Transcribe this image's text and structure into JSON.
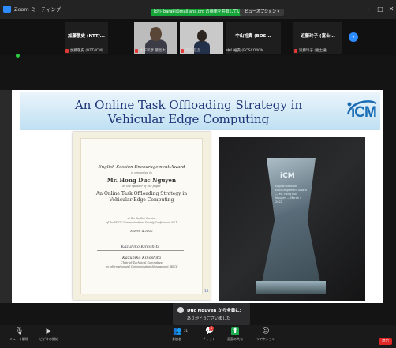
{
  "window": {
    "title": "Zoom ミーティング",
    "share_banner": "Ichi-Ibaraki@mail.ana.org の画面を共有しています",
    "view_options": "ビューオプション ▾",
    "view_link": "表示"
  },
  "participants": [
    {
      "center_name": "加藤敬史 (NTT/...",
      "footer": "加藤敬史 (NTT/ICM)",
      "muted": true,
      "has_video": false
    },
    {
      "center_name": "",
      "footer": "木下和彦 徳島大",
      "muted": true,
      "has_video": true
    },
    {
      "center_name": "",
      "footer": "阿多 信吾",
      "muted": true,
      "has_video": true
    },
    {
      "center_name": "中山裕貴 (BOS...",
      "footer": "中山裕貴 (BOSCO/ICM...",
      "muted": false,
      "has_video": false
    },
    {
      "center_name": "近藤玲子 (富士...",
      "footer": "近藤玲子 (富士通)",
      "muted": true,
      "has_video": false
    }
  ],
  "slide": {
    "title_line1": "An Online Task Offloading Strategy in",
    "title_line2": "Vehicular Edge Computing",
    "logo_text": "iCM",
    "page_number": "12"
  },
  "certificate": {
    "heading": "English Session Encouragement Award",
    "presented_to": "is presented to",
    "recipient": "Mr. Hong Duc Nguyen",
    "speaker_note": "as the speaker of the paper",
    "paper_line1": "An Online Task Offloading Strategy in",
    "paper_line2": "Vehicular Edge Computing",
    "session_line1": "at the English Session",
    "session_line2": "of the IEICE Communications Society Conference 2021",
    "date": "March 4 2022",
    "signature": "Kazuhiko Kinoshita",
    "signer": "Kazuhiko Kinoshita",
    "signer_title": "Chair of Technical Committee",
    "signer_org": "on Information and Communication Management, IEICE"
  },
  "trophy": {
    "logo": "iCM",
    "text": "English Session Encouragement Award — Mr. Hong Duc Nguyen — March 4 2022"
  },
  "chat_toast": {
    "sender": "Duc Nguyen から全員に:",
    "message": "ありがとうございました"
  },
  "toolbar": {
    "audio": "ミュート解除",
    "video": "ビデオの開始",
    "participants": "参加者",
    "participants_count": "31",
    "chat": "チャット",
    "share": "画面の共有",
    "reactions": "リアクション",
    "end": "退出"
  },
  "colors": {
    "zoom_blue": "#2d8cff",
    "share_green": "#17a53a",
    "end_red": "#e02828",
    "slide_title": "#1d3578"
  }
}
